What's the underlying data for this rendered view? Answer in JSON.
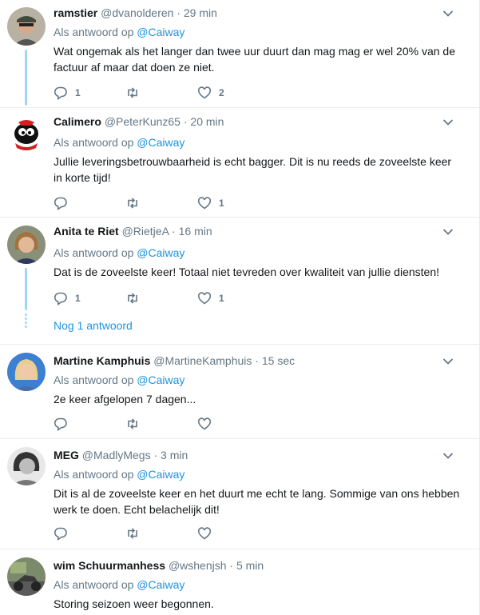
{
  "reply_prefix": "Als antwoord op",
  "tweets": [
    {
      "name": "ramstier",
      "handle": "@dvanolderen",
      "time": "29 min",
      "reply_to": "@Caiway",
      "text": "Wat ongemak als het langer dan twee uur duurt dan mag mag er wel 20% van de factuur af maar dat doen ze niet.",
      "replies": "1",
      "retweets": "",
      "likes": "2"
    },
    {
      "name": "Calimero",
      "handle": "@PeterKunz65",
      "time": "20 min",
      "reply_to": "@Caiway",
      "text": "Jullie leveringsbetrouwbaarheid is echt bagger. Dit is nu reeds de zoveelste keer in korte tijd!",
      "replies": "",
      "retweets": "",
      "likes": "1"
    },
    {
      "name": "Anita te Riet",
      "handle": "@RietjeA",
      "time": "16 min",
      "reply_to": "@Caiway",
      "text": "Dat is de zoveelste keer! Totaal niet tevreden over kwaliteit van jullie diensten!",
      "replies": "1",
      "retweets": "",
      "likes": "1",
      "more_replies": "Nog 1 antwoord"
    },
    {
      "name": "Martine Kamphuis",
      "handle": "@MartineKamphuis",
      "time": "15 sec",
      "reply_to": "@Caiway",
      "text": "2e keer afgelopen 7 dagen...",
      "replies": "",
      "retweets": "",
      "likes": ""
    },
    {
      "name": "MEG",
      "handle": "@MadlyMegs",
      "time": "3 min",
      "reply_to": "@Caiway",
      "text": "Dit is al de zoveelste keer en het duurt me echt te lang. Sommige van ons hebben werk te doen. Echt belachelijk dit!",
      "replies": "",
      "retweets": "",
      "likes": ""
    },
    {
      "name": "wim Schuurmanhess",
      "handle": "@wshenjsh",
      "time": "5 min",
      "reply_to": "@Caiway",
      "text": "Storing seizoen weer begonnen.",
      "replies": "",
      "retweets": "",
      "likes": ""
    }
  ],
  "icons": {
    "reply": "reply-icon",
    "retweet": "retweet-icon",
    "like": "like-icon",
    "menu": "chevron-down-icon"
  },
  "colors": {
    "link": "#1b95e0",
    "secondary": "#657786",
    "thread": "#9fd8ee"
  }
}
